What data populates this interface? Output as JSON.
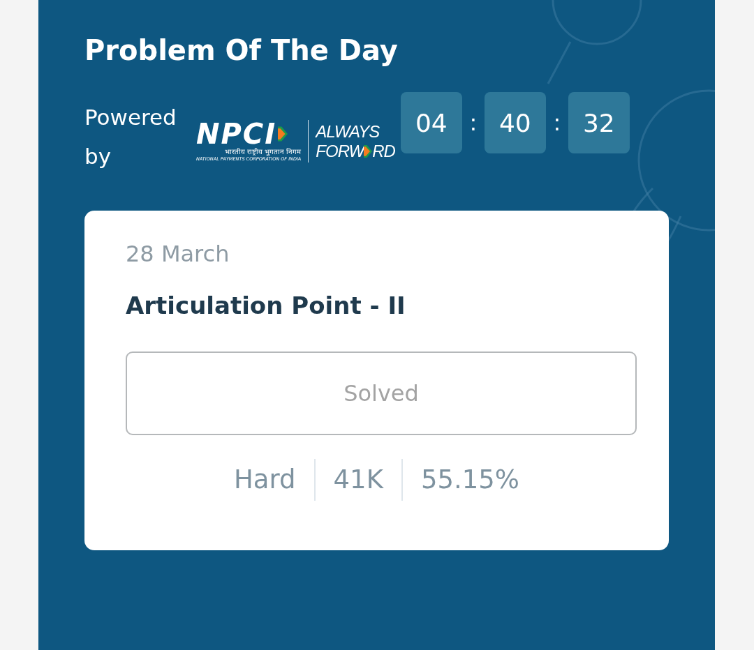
{
  "card": {
    "title": "Problem Of The Day",
    "powered_by": "Powered by",
    "logo": {
      "name": "NPCI",
      "hindi": "भारतीय राष्ट्रीय भुगतान निगम",
      "full_name": "NATIONAL PAYMENTS CORPORATION OF INDIA",
      "tagline_top": "ALWAYS",
      "tagline_start": "FORW",
      "tagline_end": "RD"
    },
    "timer": [
      {
        "kind": "digits",
        "text": "04"
      },
      {
        "kind": "separator",
        "text": ":"
      },
      {
        "kind": "digits",
        "text": "40"
      },
      {
        "kind": "separator",
        "text": ":"
      },
      {
        "kind": "digits",
        "text": "32"
      }
    ],
    "problem": {
      "date": "28 March",
      "name": "Articulation Point - II",
      "button": {
        "label": "Solved",
        "disabled": true
      },
      "stats": [
        "Hard",
        "41K",
        "55.15%"
      ]
    }
  }
}
